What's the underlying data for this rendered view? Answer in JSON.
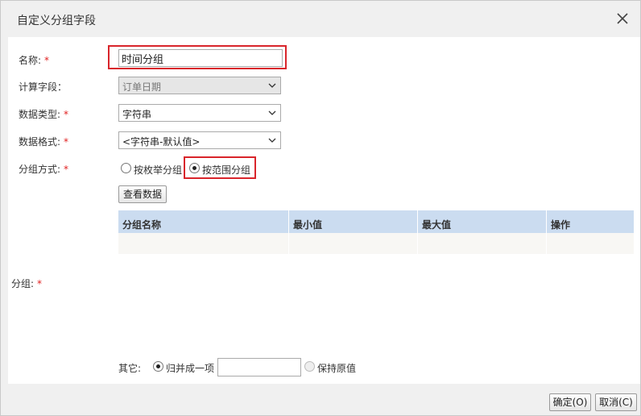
{
  "dialog": {
    "title": "自定义分组字段",
    "close_icon": "close-icon"
  },
  "form": {
    "name_label": "名称:",
    "name_value": "时间分组",
    "calc_field_label": "计算字段：",
    "calc_field_value": "订单日期",
    "data_type_label": "数据类型:",
    "data_type_value": "字符串",
    "data_format_label": "数据格式:",
    "data_format_value": "<字符串-默认值>",
    "group_method_label": "分组方式:",
    "radio_enum_label": "按枚举分组",
    "radio_range_label": "按范围分组",
    "selected_method": "按范围分组",
    "view_data_button": "查看数据",
    "group_label": "分组:",
    "required_mark": "*"
  },
  "table": {
    "headers": [
      "分组名称",
      "最小值",
      "最大值",
      "操作"
    ],
    "rows": []
  },
  "other": {
    "label": "其它:",
    "merge_label": "归并成一项",
    "merge_input_value": "",
    "keep_label": "保持原值",
    "selected": "归并成一项"
  },
  "footer": {
    "ok_label": "确定(O)",
    "cancel_label": "取消(C)"
  },
  "colors": {
    "highlight": "#d9252b",
    "required": "#e02020",
    "table_header": "#cbdcf0"
  }
}
